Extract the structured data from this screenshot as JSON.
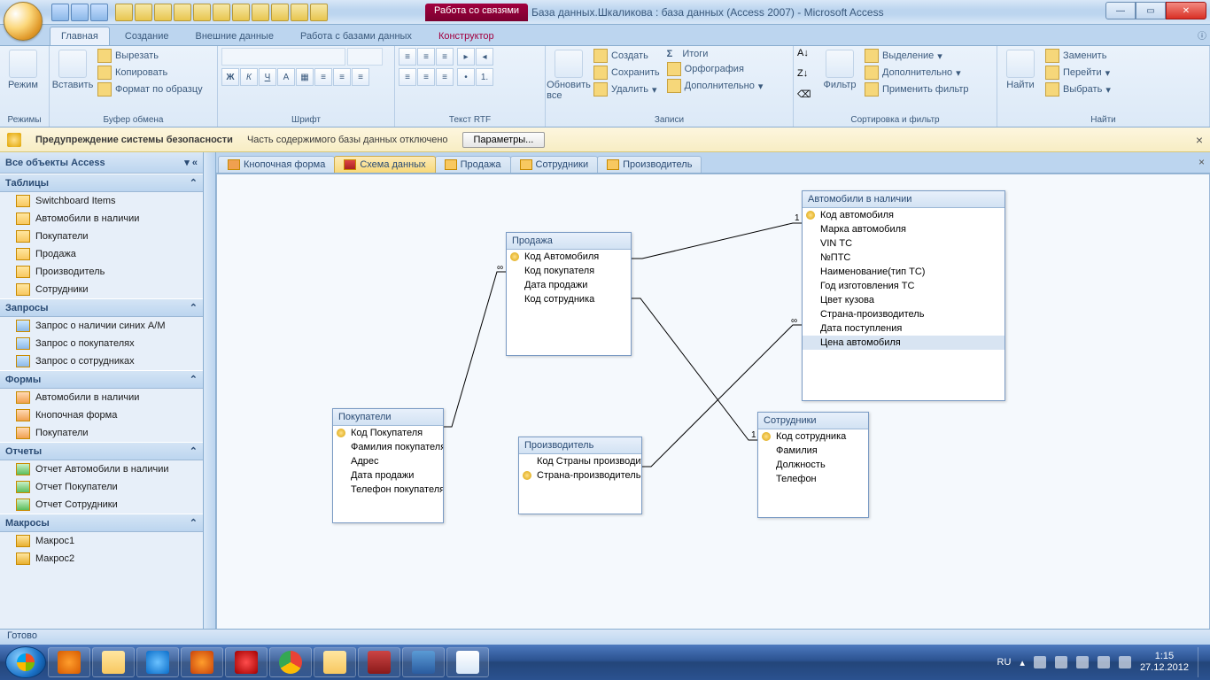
{
  "title": {
    "context_tab": "Работа со связями",
    "text": "База данных.Шкаликова : база данных (Access 2007) - Microsoft Access"
  },
  "ribbon_tabs": [
    "Главная",
    "Создание",
    "Внешние данные",
    "Работа с базами данных",
    "Конструктор"
  ],
  "ribbon_groups": {
    "modes": "Режимы",
    "mode_btn": "Режим",
    "clipboard": "Буфер обмена",
    "paste": "Вставить",
    "cut": "Вырезать",
    "copy": "Копировать",
    "format_painter": "Формат по образцу",
    "font": "Шрифт",
    "rtf": "Текст RTF",
    "refresh": "Обновить все",
    "records": "Записи",
    "new": "Создать",
    "save": "Сохранить",
    "delete": "Удалить",
    "totals": "Итоги",
    "spelling": "Орфография",
    "more": "Дополнительно",
    "sort_filter": "Сортировка и фильтр",
    "filter": "Фильтр",
    "selection": "Выделение",
    "advanced": "Дополнительно",
    "toggle": "Применить фильтр",
    "find_grp": "Найти",
    "find": "Найти",
    "replace": "Заменить",
    "goto": "Перейти",
    "select": "Выбрать"
  },
  "security": {
    "title": "Предупреждение системы безопасности",
    "msg": "Часть содержимого базы данных отключено",
    "btn": "Параметры..."
  },
  "nav": {
    "header": "Все объекты Access",
    "cats": {
      "tables": "Таблицы",
      "queries": "Запросы",
      "forms": "Формы",
      "reports": "Отчеты",
      "macros": "Макросы"
    },
    "tables": [
      "Switchboard Items",
      "Автомобили в наличии",
      "Покупатели",
      "Продажа",
      "Производитель",
      "Сотрудники"
    ],
    "queries": [
      "Запрос о наличии синих А/М",
      "Запрос о покупателях",
      "Запрос о сотрудниках"
    ],
    "forms": [
      "Автомобили в наличии",
      "Кнопочная форма",
      "Покупатели"
    ],
    "reports": [
      "Отчет Автомобили в наличии",
      "Отчет Покупатели",
      "Отчет Сотрудники"
    ],
    "macros": [
      "Макрос1",
      "Макрос2"
    ]
  },
  "doc_tabs": [
    "Кнопочная форма",
    "Схема данных",
    "Продажа",
    "Сотрудники",
    "Производитель"
  ],
  "schema": {
    "t_sale": {
      "title": "Продажа",
      "fields": [
        "Код Автомобиля",
        "Код покупателя",
        "Дата продажи",
        "Код сотрудника"
      ]
    },
    "t_cars": {
      "title": "Автомобили в наличии",
      "fields": [
        "Код автомобиля",
        "Марка автомобиля",
        "VIN ТС",
        "№ПТС",
        "Наименование(тип ТС)",
        "Год изготовления ТС",
        "Цвет кузова",
        "Страна-производитель",
        "Дата поступления",
        "Цена автомобиля"
      ]
    },
    "t_buyers": {
      "title": "Покупатели",
      "fields": [
        "Код Покупателя",
        "Фамилия покупателя",
        "Адрес",
        "Дата продажи",
        "Телефон покупателя"
      ]
    },
    "t_vendor": {
      "title": "Производитель",
      "fields": [
        "Код Страны производителя",
        "Страна-производитель"
      ]
    },
    "t_staff": {
      "title": "Сотрудники",
      "fields": [
        "Код сотрудника",
        "Фамилия",
        "Должность",
        "Телефон"
      ]
    }
  },
  "status": "Готово",
  "tray": {
    "lang": "RU",
    "time": "1:15",
    "date": "27.12.2012"
  }
}
